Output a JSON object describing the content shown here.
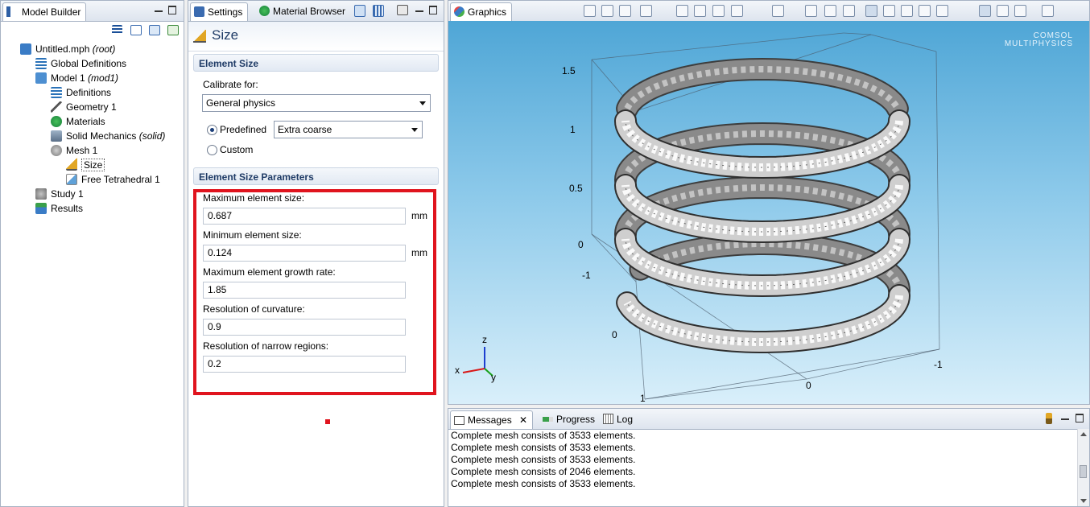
{
  "model_builder": {
    "title": "Model Builder",
    "tree": [
      {
        "label": "Untitled.mph",
        "suffix": "(root)"
      },
      {
        "label": "Global Definitions",
        "suffix": ""
      },
      {
        "label": "Model 1",
        "suffix": "(mod1)"
      },
      {
        "label": "Definitions",
        "suffix": ""
      },
      {
        "label": "Geometry 1",
        "suffix": ""
      },
      {
        "label": "Materials",
        "suffix": ""
      },
      {
        "label": "Solid Mechanics",
        "suffix": "(solid)"
      },
      {
        "label": "Mesh 1",
        "suffix": ""
      },
      {
        "label": "Size",
        "suffix": ""
      },
      {
        "label": "Free Tetrahedral 1",
        "suffix": ""
      },
      {
        "label": "Study 1",
        "suffix": ""
      },
      {
        "label": "Results",
        "suffix": ""
      }
    ]
  },
  "settings": {
    "tab_label": "Settings",
    "tab2_label": "Material Browser",
    "page_title": "Size",
    "element_size": {
      "header": "Element Size",
      "calibrate_label": "Calibrate for:",
      "calibrate_value": "General physics",
      "predefined_label": "Predefined",
      "predefined_value": "Extra coarse",
      "custom_label": "Custom"
    },
    "params": {
      "header": "Element Size Parameters",
      "max_size_label": "Maximum element size:",
      "max_size_value": "0.687",
      "max_size_unit": "mm",
      "min_size_label": "Minimum element size:",
      "min_size_value": "0.124",
      "min_size_unit": "mm",
      "growth_label": "Maximum element growth rate:",
      "growth_value": "1.85",
      "curv_label": "Resolution of curvature:",
      "curv_value": "0.9",
      "narrow_label": "Resolution of narrow regions:",
      "narrow_value": "0.2"
    }
  },
  "graphics": {
    "title": "Graphics",
    "logo_line1": "COMSOL",
    "logo_line2": "MULTIPHYSICS",
    "z_ticks": [
      "1.5",
      "1",
      "0.5",
      "0",
      "-1"
    ],
    "bottom_ticks": [
      "0",
      "0",
      "1",
      "-1"
    ],
    "triad": {
      "x": "x",
      "y": "y",
      "z": "z"
    }
  },
  "messages": {
    "tab_messages": "Messages",
    "tab_progress": "Progress",
    "tab_log": "Log",
    "lines": [
      "Complete mesh consists of 3533 elements.",
      "Complete mesh consists of 3533 elements.",
      "Complete mesh consists of 3533 elements.",
      "Complete mesh consists of 2046 elements.",
      "Complete mesh consists of 3533 elements."
    ]
  },
  "colors": {
    "highlight_box": "#e0141e",
    "accent": "#1f3b66"
  }
}
